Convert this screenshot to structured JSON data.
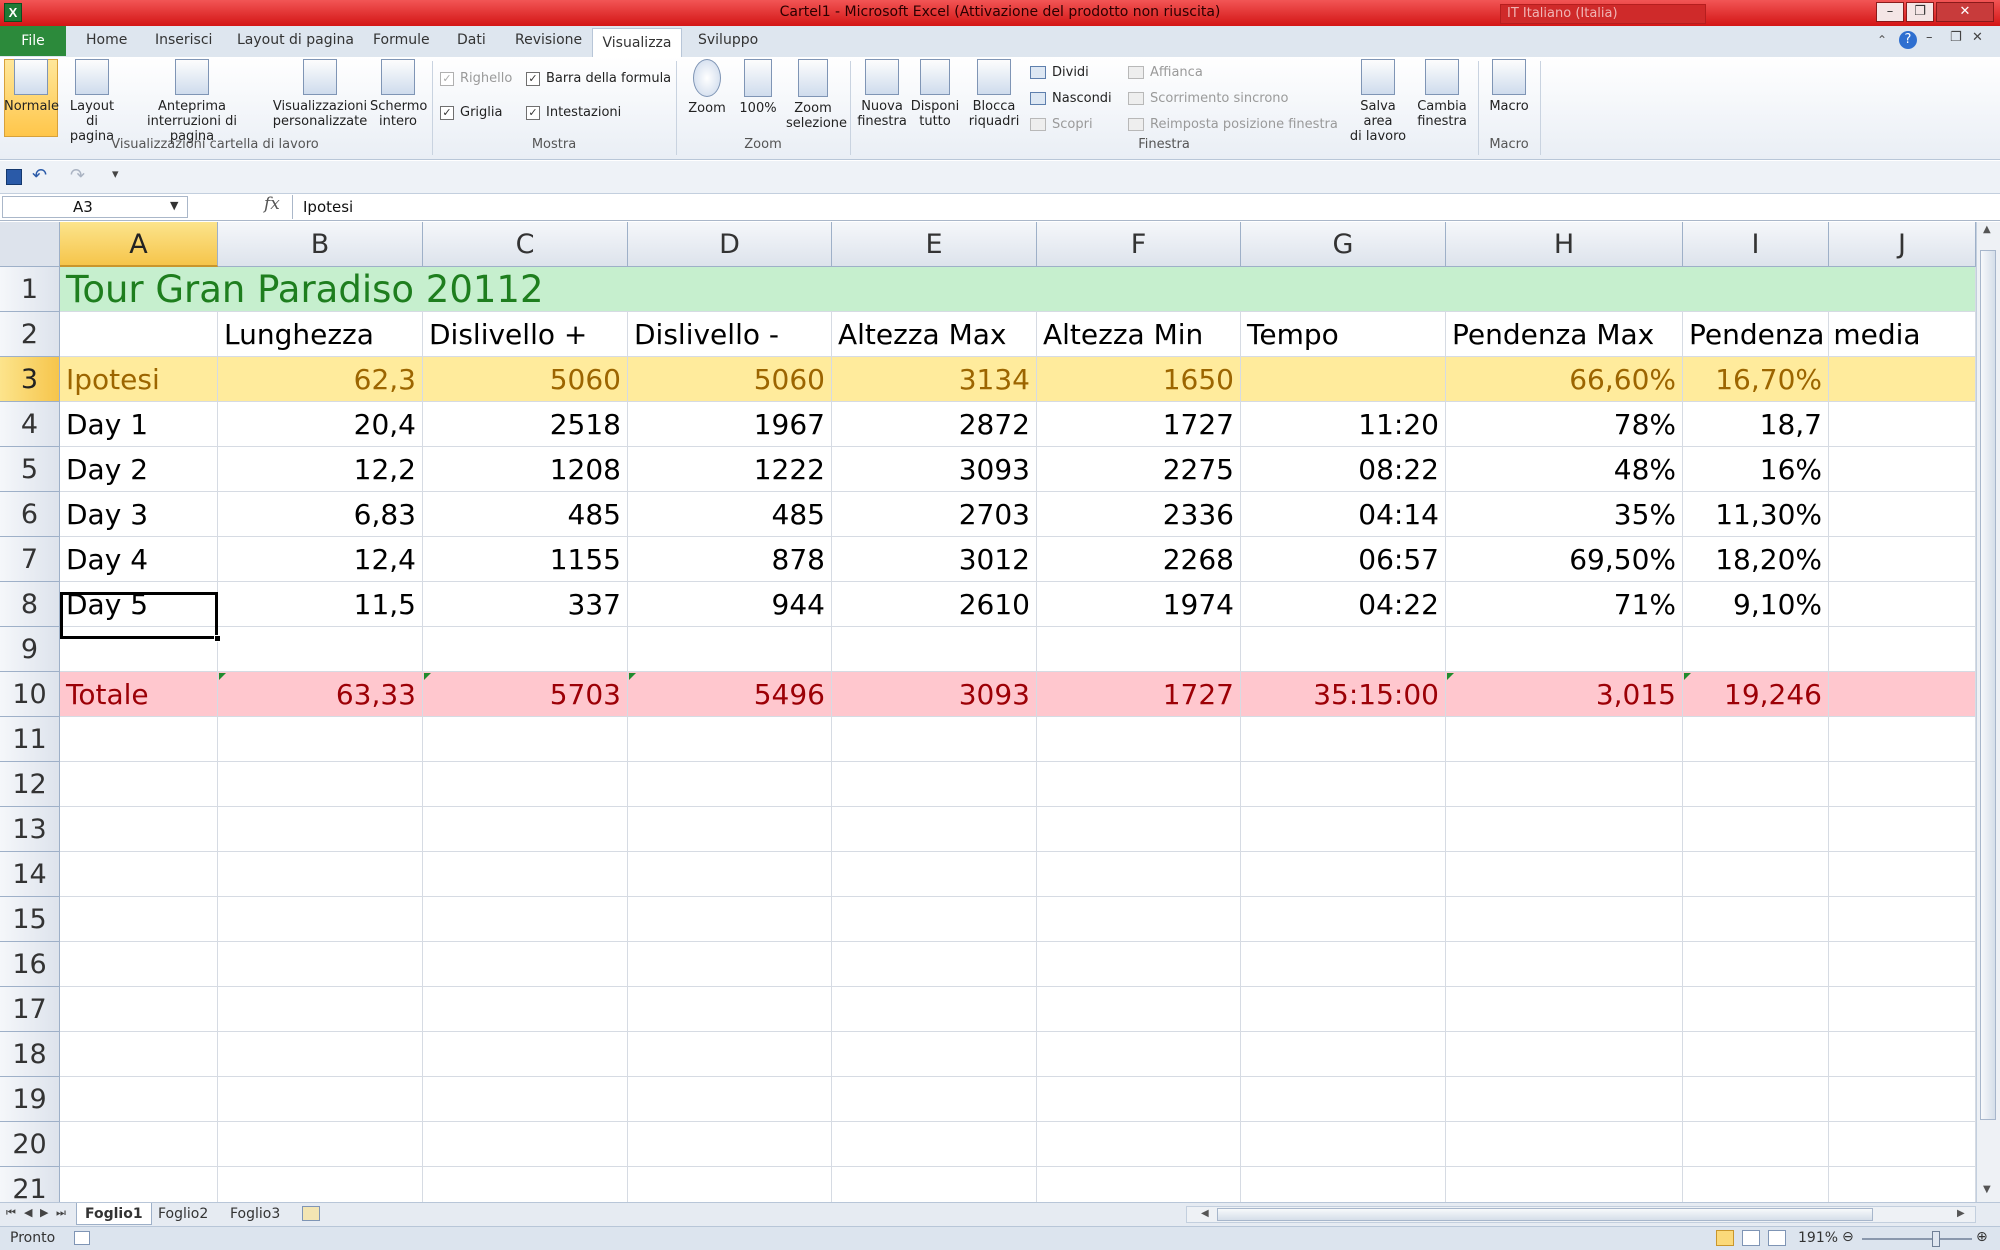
{
  "window": {
    "title": "Cartel1  -  Microsoft Excel (Attivazione del prodotto non riuscita)",
    "language": "IT Italiano (Italia)",
    "app_icon": "X"
  },
  "tabs": {
    "file": "File",
    "items": [
      "Home",
      "Inserisci",
      "Layout di pagina",
      "Formule",
      "Dati",
      "Revisione"
    ],
    "active": "Visualizza",
    "after": [
      "Sviluppo"
    ]
  },
  "ribbon": {
    "views": {
      "normale": "Normale",
      "layout_1": "Layout di",
      "layout_2": "pagina",
      "anteprima_1": "Anteprima",
      "anteprima_2": "interruzioni di pagina",
      "personalizzate_1": "Visualizzazioni",
      "personalizzate_2": "personalizzate",
      "schermo_1": "Schermo",
      "schermo_2": "intero",
      "group": "Visualizzazioni cartella di lavoro"
    },
    "mostra": {
      "righello": "Righello",
      "barra_formula": "Barra della formula",
      "griglia": "Griglia",
      "intestazioni": "Intestazioni",
      "group": "Mostra"
    },
    "zoom": {
      "zoom": "Zoom",
      "cento": "100%",
      "zoom_sel_1": "Zoom",
      "zoom_sel_2": "selezione",
      "group": "Zoom"
    },
    "finestra": {
      "nuova_1": "Nuova",
      "nuova_2": "finestra",
      "disponi_1": "Disponi",
      "disponi_2": "tutto",
      "blocca_1": "Blocca",
      "blocca_2": "riquadri",
      "dividi": "Dividi",
      "nascondi": "Nascondi",
      "scopri": "Scopri",
      "affianca": "Affianca",
      "scorrimento": "Scorrimento sincrono",
      "reimposta": "Reimposta posizione finestra",
      "salva_1": "Salva area",
      "salva_2": "di lavoro",
      "cambia_1": "Cambia",
      "cambia_2": "finestra",
      "group": "Finestra"
    },
    "macro": {
      "macro": "Macro",
      "group": "Macro"
    }
  },
  "formula_bar": {
    "name_box": "A3",
    "fx": "fx",
    "value": "Ipotesi"
  },
  "columns": [
    "A",
    "B",
    "C",
    "D",
    "E",
    "F",
    "G",
    "H",
    "I",
    "J"
  ],
  "rows": [
    "1",
    "2",
    "3",
    "4",
    "5",
    "6",
    "7",
    "8",
    "9",
    "10",
    "11",
    "12",
    "13",
    "14",
    "15",
    "16",
    "17",
    "18",
    "19",
    "20",
    "21"
  ],
  "sheet": {
    "title": "Tour Gran Paradiso 20112",
    "headers": [
      "",
      "Lunghezza",
      "Dislivello +",
      "Dislivello -",
      "Altezza Max",
      "Altezza Min",
      "Tempo",
      "Pendenza Max",
      "Pendenza media"
    ],
    "ipotesi": [
      "Ipotesi",
      "62,3",
      "5060",
      "5060",
      "3134",
      "1650",
      "",
      "66,60%",
      "16,70%"
    ],
    "days": [
      [
        "Day 1",
        "20,4",
        "2518",
        "1967",
        "2872",
        "1727",
        "11:20",
        "78%",
        "18,7"
      ],
      [
        "Day 2",
        "12,2",
        "1208",
        "1222",
        "3093",
        "2275",
        "08:22",
        "48%",
        "16%"
      ],
      [
        "Day 3",
        "6,83",
        "485",
        "485",
        "2703",
        "2336",
        "04:14",
        "35%",
        "11,30%"
      ],
      [
        "Day 4",
        "12,4",
        "1155",
        "878",
        "3012",
        "2268",
        "06:57",
        "69,50%",
        "18,20%"
      ],
      [
        "Day 5",
        "11,5",
        "337",
        "944",
        "2610",
        "1974",
        "04:22",
        "71%",
        "9,10%"
      ]
    ],
    "totale": [
      "Totale",
      "63,33",
      "5703",
      "5496",
      "3093",
      "1727",
      "35:15:00",
      "3,015",
      "19,246"
    ]
  },
  "sheet_tabs": [
    "Foglio1",
    "Foglio2",
    "Foglio3"
  ],
  "status": {
    "ready": "Pronto",
    "zoom": "191%"
  },
  "colors": {
    "title_fill": "#c6efce",
    "title_text": "#1e7e1e",
    "ipotesi_fill": "#ffeb9c",
    "ipotesi_text": "#9c6500",
    "totale_fill": "#ffc7ce",
    "totale_text": "#9c0006"
  }
}
